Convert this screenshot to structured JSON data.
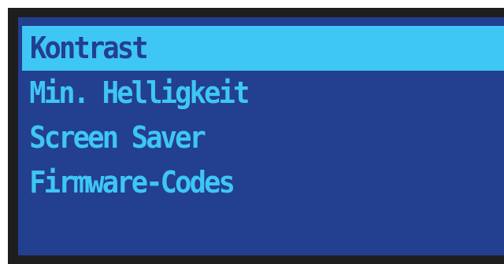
{
  "menu": {
    "items": [
      {
        "label": "Kontrast",
        "selected": true
      },
      {
        "label": "Min. Helligkeit",
        "selected": false
      },
      {
        "label": "Screen Saver",
        "selected": false
      },
      {
        "label": "Firmware-Codes",
        "selected": false
      }
    ]
  },
  "colors": {
    "bezel": "#1e1e21",
    "screen_background": "#233f8f",
    "text": "#3ec6f5",
    "highlight": "#3ec6f5"
  }
}
